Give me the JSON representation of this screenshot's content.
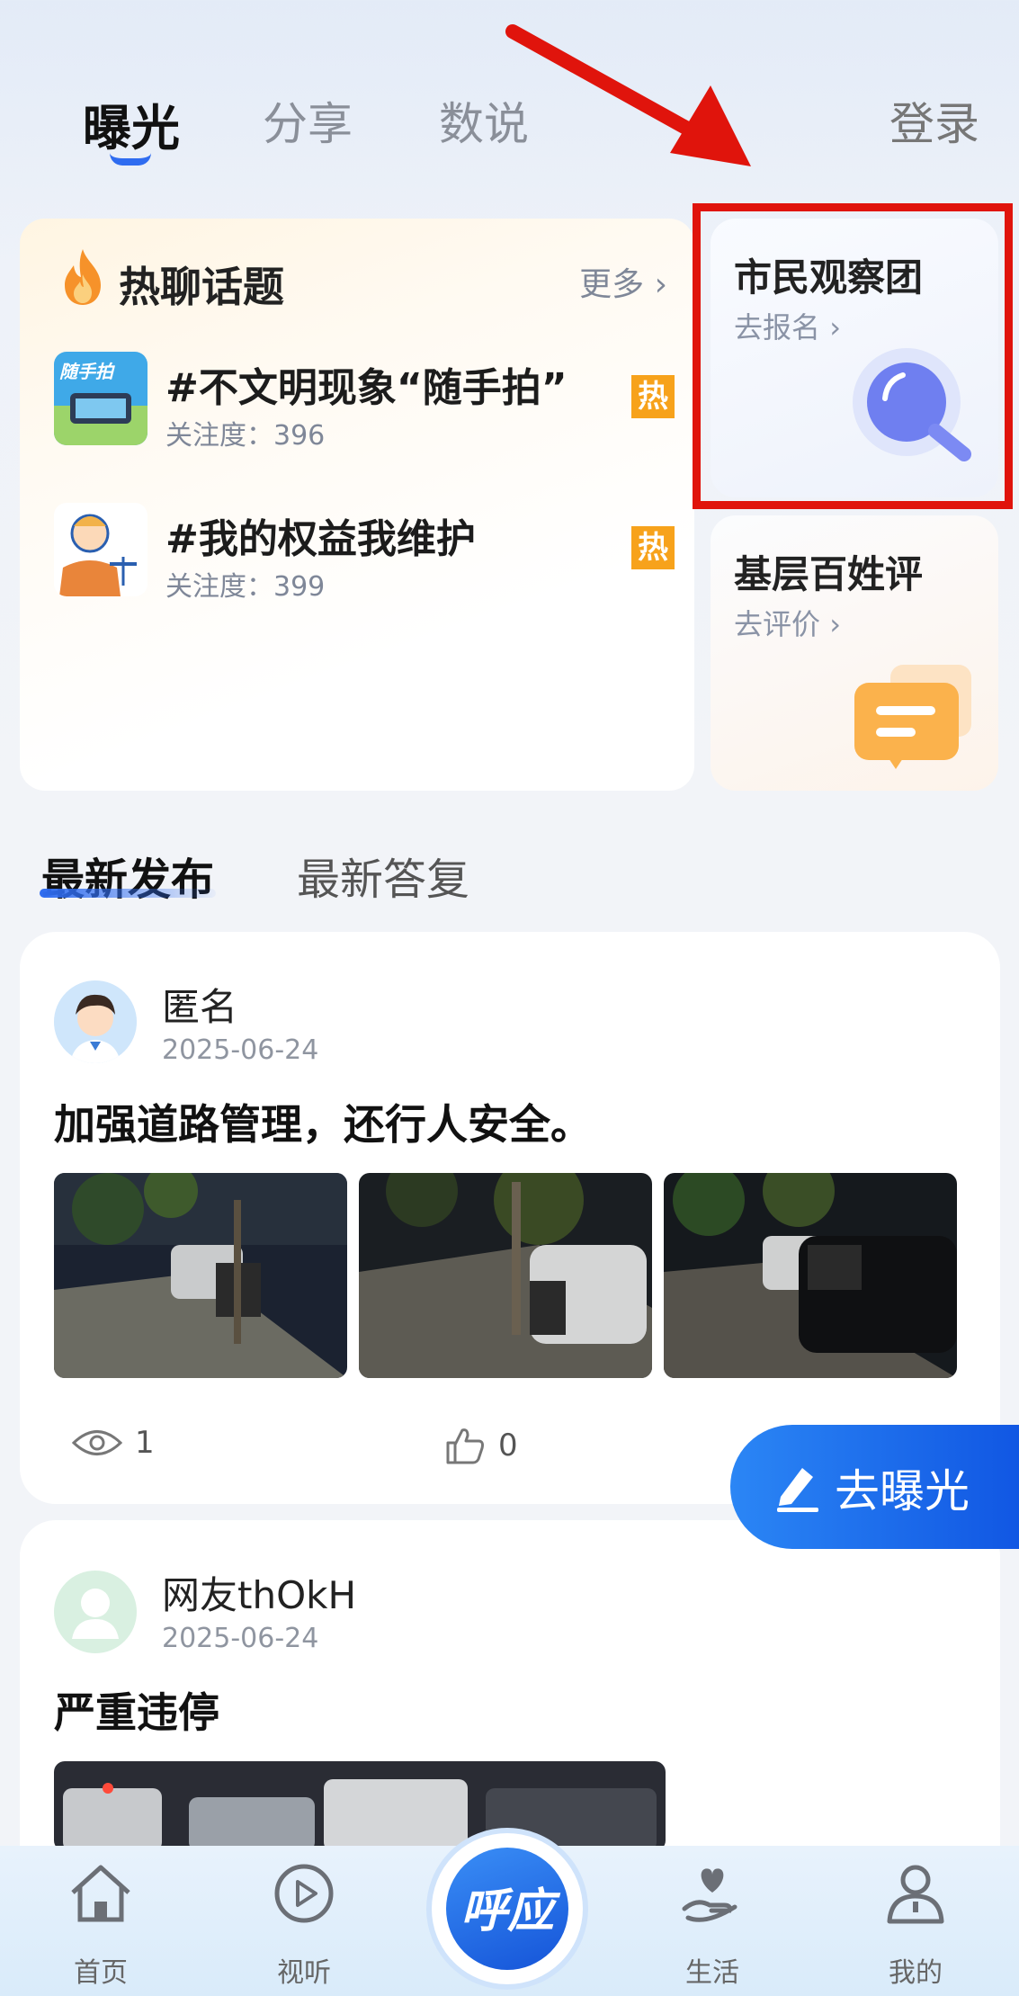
{
  "top_tabs": [
    {
      "label": "曝光"
    },
    {
      "label": "分享"
    },
    {
      "label": "数说"
    }
  ],
  "login": "登录",
  "hot_topics": {
    "title": "热聊话题",
    "more": "更多",
    "items": [
      {
        "title": "#不文明现象“随手拍”",
        "attention_label": "关注度：396",
        "badge": "热",
        "thumb_text": "随手拍"
      },
      {
        "title": "#我的权益我维护",
        "attention_label": "关注度：399",
        "badge": "热"
      }
    ]
  },
  "side_cards": {
    "observe": {
      "title": "市民观察团",
      "link": "去报名"
    },
    "grassroots": {
      "title": "基层百姓评",
      "link": "去评价"
    }
  },
  "section_tabs": [
    {
      "label": "最新发布"
    },
    {
      "label": "最新答复"
    }
  ],
  "posts": [
    {
      "author": "匿名",
      "date": "2025-06-24",
      "title": "加强道路管理，还行人安全。",
      "views": "1",
      "likes": "0"
    },
    {
      "author": "网友thOkH",
      "date": "2025-06-24",
      "title": "严重违停"
    }
  ],
  "fab": {
    "label": "去曝光"
  },
  "bottom_nav": {
    "items": [
      {
        "label": "首页",
        "icon": "home-icon"
      },
      {
        "label": "视听",
        "icon": "play-icon"
      },
      {
        "label": "生活",
        "icon": "heart-hand-icon"
      },
      {
        "label": "我的",
        "icon": "person-icon"
      }
    ],
    "center_text": "呼应"
  },
  "colors": {
    "accent": "#2f6cf0",
    "hot_badge": "#f7a21b",
    "annotation": "#e0140c"
  }
}
